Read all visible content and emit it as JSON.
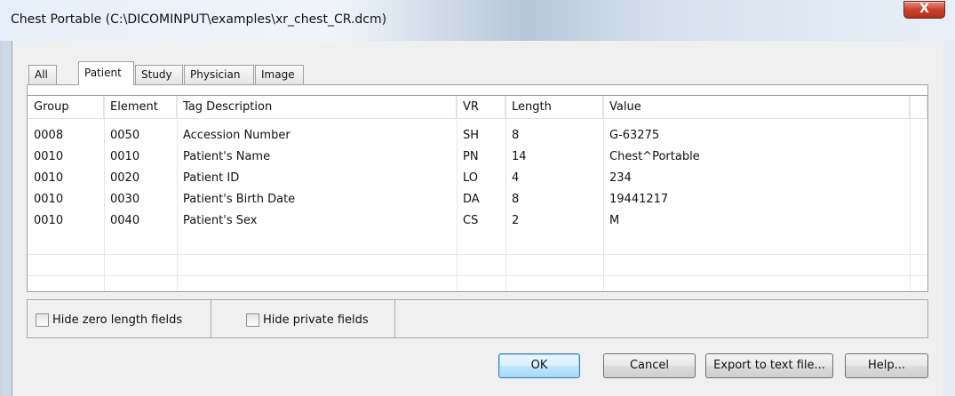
{
  "window": {
    "title": "Chest Portable (C:\\DICOMINPUT\\examples\\xr_chest_CR.dcm)",
    "close_label": "X"
  },
  "tabs": [
    {
      "label": "All"
    },
    {
      "label": "Patient"
    },
    {
      "label": "Study"
    },
    {
      "label": "Physician"
    },
    {
      "label": "Image"
    }
  ],
  "active_tab": "Patient",
  "table": {
    "columns": [
      "Group",
      "Element",
      "Tag Description",
      "VR",
      "Length",
      "Value"
    ],
    "rows": [
      [
        "0008",
        "0050",
        "Accession Number",
        "SH",
        "8",
        "G-63275"
      ],
      [
        "0010",
        "0010",
        "Patient's Name",
        "PN",
        "14",
        "Chest^Portable"
      ],
      [
        "0010",
        "0020",
        "Patient ID",
        "LO",
        "4",
        "234"
      ],
      [
        "0010",
        "0030",
        "Patient's Birth Date",
        "DA",
        "8",
        "19441217"
      ],
      [
        "0010",
        "0040",
        "Patient's Sex",
        "CS",
        "2",
        "M"
      ]
    ]
  },
  "options": {
    "hide_zero_length": {
      "label": "Hide zero length fields",
      "checked": false
    },
    "hide_private": {
      "label": "Hide private fields",
      "checked": false
    }
  },
  "buttons": {
    "ok": "OK",
    "cancel": "Cancel",
    "export": "Export to text file...",
    "help": "Help..."
  },
  "colors": {
    "close_button": "#c9412d",
    "default_button_border": "#3c7fb1"
  }
}
